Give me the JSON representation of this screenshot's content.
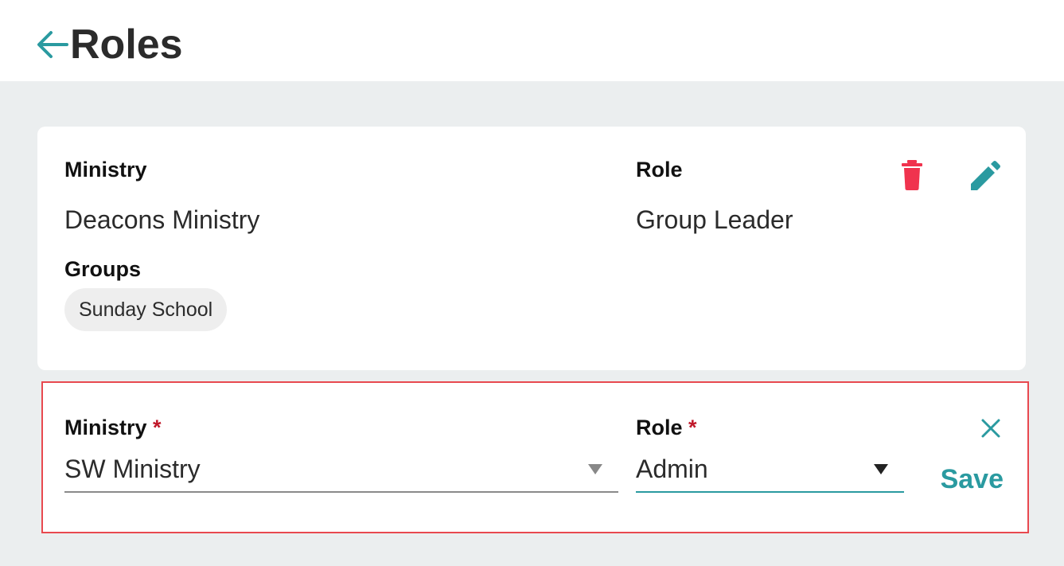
{
  "header": {
    "title": "Roles",
    "back_icon": "arrow-left-icon"
  },
  "role_card": {
    "ministry_label": "Ministry",
    "ministry_value": "Deacons Ministry",
    "role_label": "Role",
    "role_value": "Group Leader",
    "groups_label": "Groups",
    "groups": [
      "Sunday School"
    ],
    "delete_icon": "trash-icon",
    "edit_icon": "pencil-icon"
  },
  "edit_form": {
    "ministry_label": "Ministry",
    "role_label": "Role",
    "required_mark": "*",
    "ministry_value": "SW Ministry",
    "role_value": "Admin",
    "close_icon": "close-icon",
    "save_label": "Save"
  },
  "colors": {
    "accent": "#2a9aa0",
    "danger": "#f0334e",
    "highlight_border": "#e8494f",
    "background": "#ebeeef"
  }
}
